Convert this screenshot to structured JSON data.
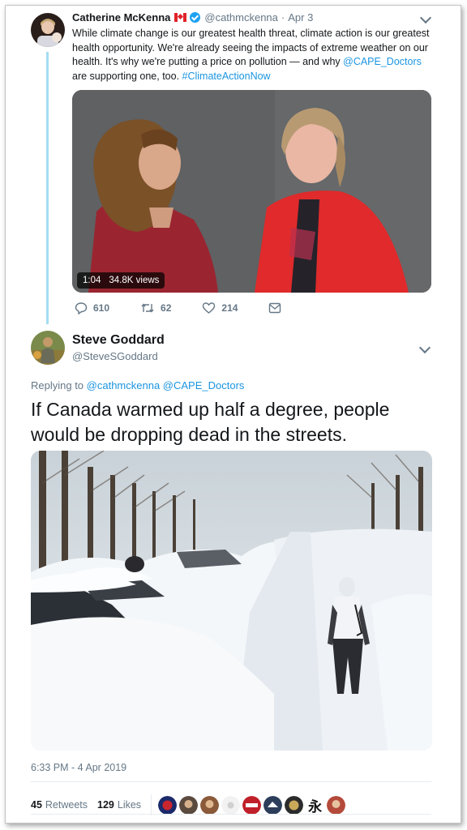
{
  "tweet1": {
    "author_name": "Catherine McKenna",
    "author_handle": "@cathmckenna",
    "separator": "·",
    "date": "Apr 3",
    "text_part1": "While climate change is our greatest health threat, climate action is our greatest health opportunity. We're already seeing the impacts of extreme weather on our health. It's why we're putting a price on pollution — and why ",
    "mention": "@CAPE_Doctors",
    "text_part2": " are supporting one, too. ",
    "hashtag": "#ClimateActionNow",
    "video": {
      "duration": "1:04",
      "views": "34.8K views"
    },
    "actions": {
      "replies": "610",
      "retweets": "62",
      "likes": "214"
    },
    "icons": [
      "canada-flag-icon",
      "verified-icon",
      "chevron-down-icon",
      "reply-icon",
      "retweet-icon",
      "like-icon",
      "message-icon"
    ]
  },
  "tweet2": {
    "author_name": "Steve Goddard",
    "author_handle": "@SteveSGoddard",
    "replying_prefix": "Replying to ",
    "replying_to": "@cathmckenna @CAPE_Doctors",
    "text": "If Canada warmed up half a degree, people would be dropping dead in the streets.",
    "timestamp": "6:33 PM - 4 Apr 2019",
    "retweets_count": "45",
    "retweets_label": "Retweets",
    "likes_count": "129",
    "likes_label": "Likes",
    "liker_glyph": "永"
  },
  "colors": {
    "link": "#1b95e0",
    "muted": "#657786",
    "thread_line": "#a5dcf3",
    "verified": "#1da1f2"
  }
}
